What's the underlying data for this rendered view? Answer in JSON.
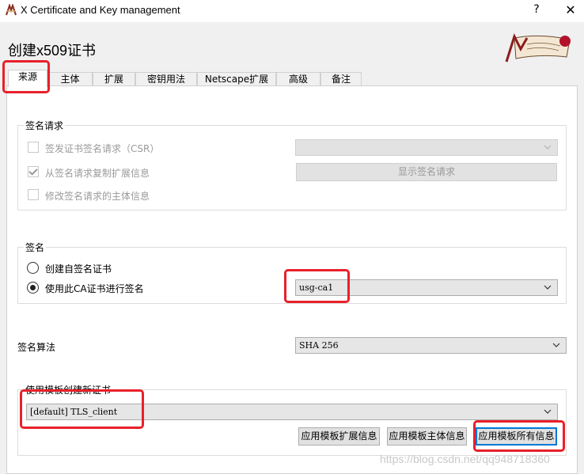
{
  "window": {
    "title": "X Certificate and Key management",
    "help_glyph": "?",
    "close_glyph": "✕"
  },
  "dialog": {
    "heading": "创建x509证书"
  },
  "tabs": [
    {
      "label": "来源",
      "active": true
    },
    {
      "label": "主体"
    },
    {
      "label": "扩展"
    },
    {
      "label": "密钥用法"
    },
    {
      "label": "Netscape扩展"
    },
    {
      "label": "高级"
    },
    {
      "label": "备注"
    }
  ],
  "signing_request": {
    "title": "签名请求",
    "sign_csr_label": "签发证书签名请求（CSR）",
    "copy_ext_label": "从签名请求复制扩展信息",
    "modify_subject_label": "修改签名请求的主体信息",
    "csr_select_value": "",
    "show_request_label": "显示签名请求"
  },
  "signing": {
    "title": "签名",
    "self_signed_label": "创建自签名证书",
    "use_ca_label": "使用此CA证书进行签名",
    "ca_select_value": "usg-ca1"
  },
  "algorithm": {
    "label": "签名算法",
    "value": "SHA 256"
  },
  "template": {
    "title": "使用模板创建新证书",
    "value": "[default] TLS_client",
    "apply_ext_label": "应用模板扩展信息",
    "apply_subject_label": "应用模板主体信息",
    "apply_all_label": "应用模板所有信息"
  },
  "watermark": "https://blog.csdn.net/qq948718360",
  "colors": {
    "highlight": "#e8202a",
    "focus": "#0078d7"
  }
}
